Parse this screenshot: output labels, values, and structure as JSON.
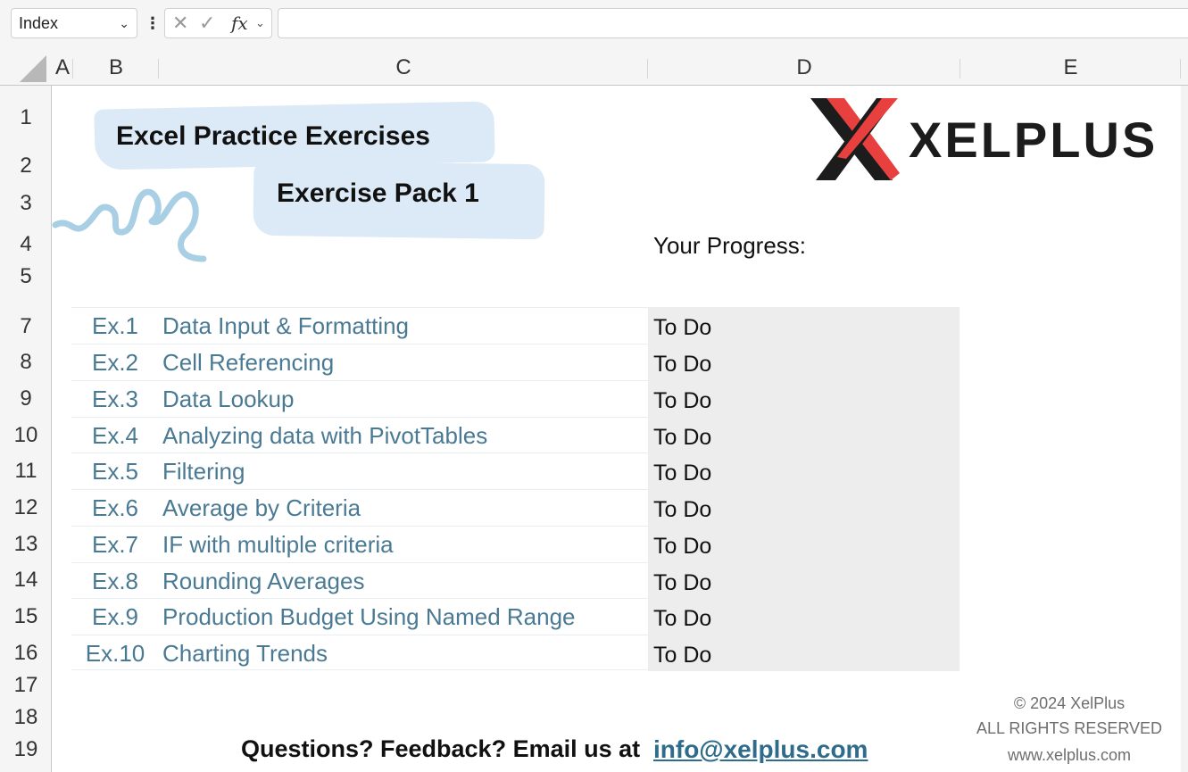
{
  "formula_bar": {
    "name_box": "Index",
    "fx_label": "fx",
    "formula": ""
  },
  "columns": [
    "A",
    "B",
    "C",
    "D",
    "E"
  ],
  "rows": [
    "1",
    "2",
    "3",
    "4",
    "5",
    "7",
    "8",
    "9",
    "10",
    "11",
    "12",
    "13",
    "14",
    "15",
    "16",
    "17",
    "18",
    "19"
  ],
  "header": {
    "title": "Excel Practice Exercises",
    "subtitle": "Exercise Pack 1",
    "brand": "XELPLUS",
    "progress_label": "Your Progress:"
  },
  "exercises": [
    {
      "num": "Ex.1",
      "name": "Data Input & Formatting",
      "status": "To Do"
    },
    {
      "num": "Ex.2",
      "name": "Cell Referencing",
      "status": "To Do"
    },
    {
      "num": "Ex.3",
      "name": "Data Lookup",
      "status": "To Do"
    },
    {
      "num": "Ex.4",
      "name": "Analyzing data with PivotTables",
      "status": "To Do"
    },
    {
      "num": "Ex.5",
      "name": "Filtering",
      "status": "To Do"
    },
    {
      "num": "Ex.6",
      "name": "Average by Criteria",
      "status": "To Do"
    },
    {
      "num": "Ex.7",
      "name": "IF with multiple criteria",
      "status": "To Do"
    },
    {
      "num": "Ex.8",
      "name": "Rounding Averages",
      "status": "To Do"
    },
    {
      "num": "Ex.9",
      "name": "Production Budget Using Named Range",
      "status": "To Do"
    },
    {
      "num": "Ex.10",
      "name": "Charting Trends",
      "status": "To Do"
    }
  ],
  "footer": {
    "questions": "Questions? Feedback? Email us at",
    "email": "info@xelplus.com",
    "copyright": "© 2024 XelPlus",
    "rights": "ALL RIGHTS RESERVED",
    "website": "www.xelplus.com"
  },
  "colors": {
    "exercise_text": "#4a7a93",
    "highlight_blue": "#dbeaf6",
    "logo_red": "#e8403f",
    "logo_dark": "#1c1c1c",
    "progress_fill": "#ededed"
  }
}
